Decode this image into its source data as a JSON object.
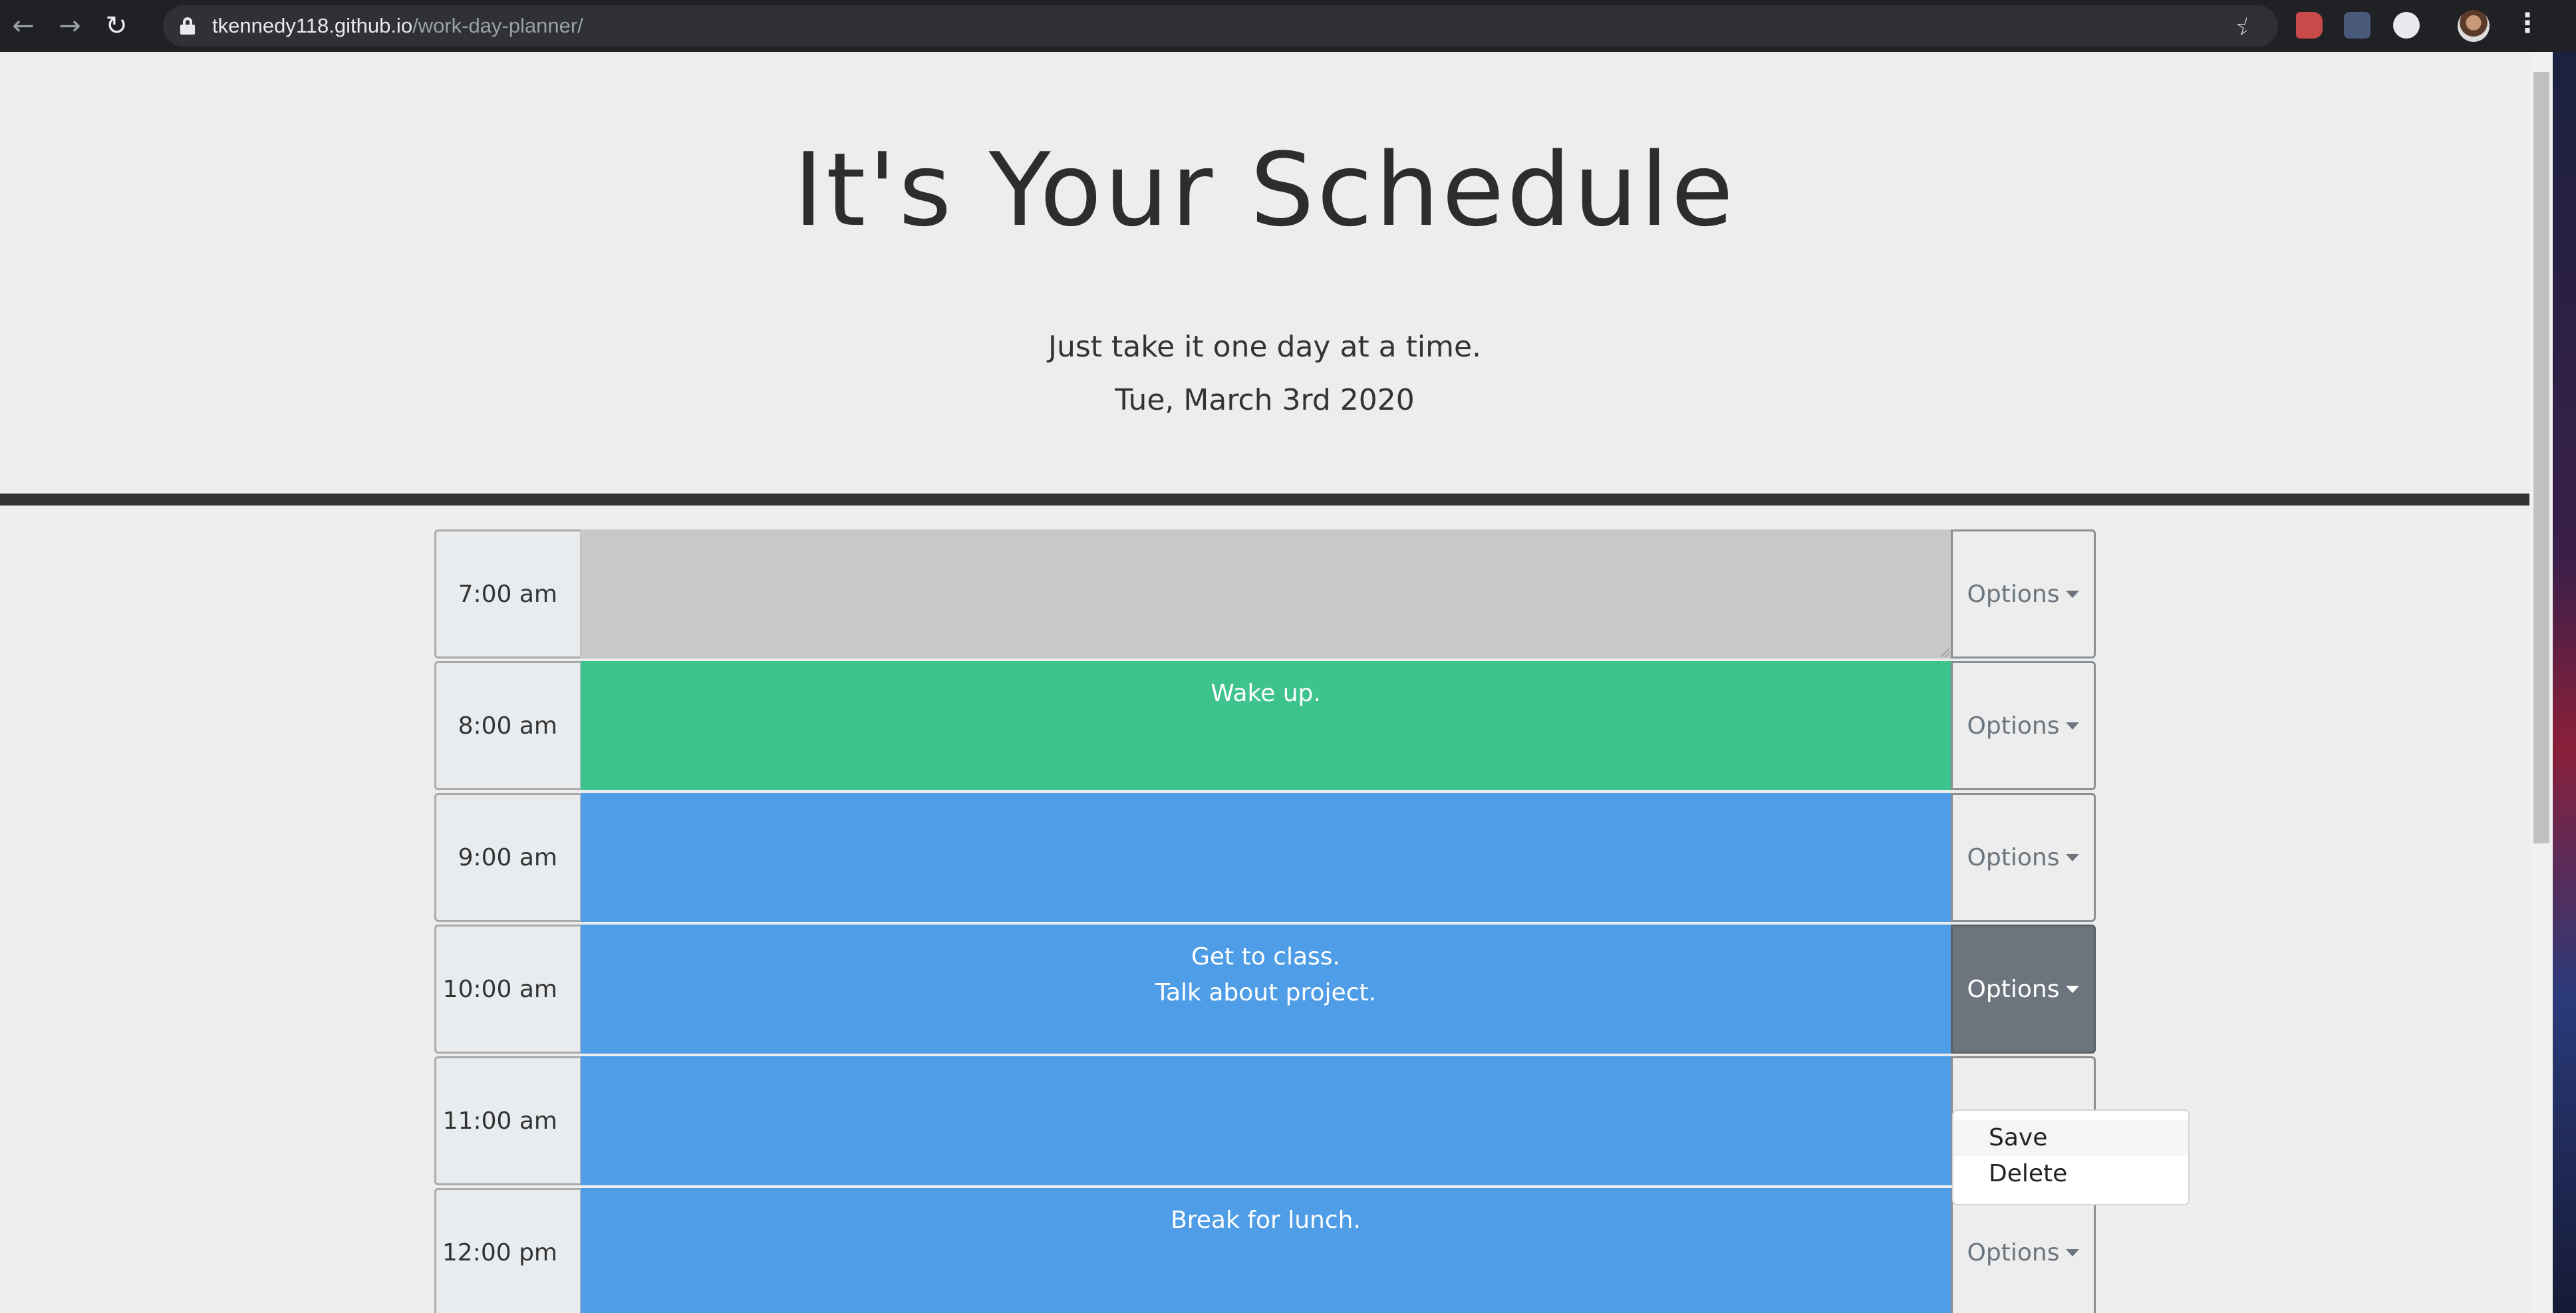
{
  "browser": {
    "url_host": "tkennedy118.github.io",
    "url_path": "/work-day-planner/"
  },
  "header": {
    "title": "It's Your Schedule",
    "lead": "Just take it one day at a time.",
    "date": "Tue, March 3rd 2020"
  },
  "rows": [
    {
      "hour": "7:00 am",
      "lines": [],
      "state": "past",
      "options_label": "Options"
    },
    {
      "hour": "8:00 am",
      "lines": [
        "Wake up."
      ],
      "state": "present",
      "options_label": "Options"
    },
    {
      "hour": "9:00 am",
      "lines": [],
      "state": "future",
      "options_label": "Options"
    },
    {
      "hour": "10:00 am",
      "lines": [
        "Get to class.",
        "Talk about project."
      ],
      "state": "future",
      "options_label": "Options"
    },
    {
      "hour": "11:00 am",
      "lines": [],
      "state": "future",
      "options_label": "Options"
    },
    {
      "hour": "12:00 pm",
      "lines": [
        "Break for lunch."
      ],
      "state": "future",
      "options_label": "Options"
    }
  ],
  "dropdown": {
    "items": [
      "Save",
      "Delete"
    ]
  },
  "colors": {
    "past": "#c8c8c8",
    "present": "#3ec38d",
    "future": "#4f9de6",
    "options_active": "#6c757d"
  },
  "icons": {
    "back": "arrow-left-icon",
    "forward": "arrow-right-icon",
    "reload": "reload-icon",
    "lock": "lock-icon",
    "bookmark": "star-icon",
    "menu": "kebab-menu-icon",
    "caret": "caret-down-icon"
  }
}
